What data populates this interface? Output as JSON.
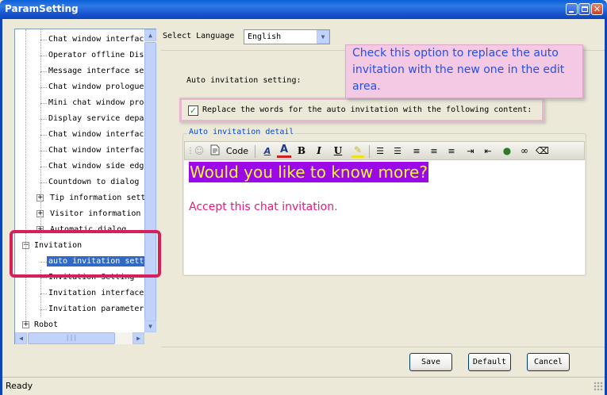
{
  "window": {
    "title": "ParamSetting",
    "controls": {
      "minimize": "minimize-icon",
      "maximize": "maximize-icon",
      "close": "close-icon"
    }
  },
  "tree": {
    "items": [
      {
        "label": "Chat window interfac",
        "level": 1
      },
      {
        "label": "Operator offline Dis",
        "level": 1
      },
      {
        "label": "Message interface se",
        "level": 1
      },
      {
        "label": "Chat window prologue",
        "level": 1
      },
      {
        "label": "Mini chat window pro",
        "level": 1
      },
      {
        "label": "Display service depa",
        "level": 1
      },
      {
        "label": "Chat window interfac",
        "level": 1
      },
      {
        "label": "Chat window interfac",
        "level": 1
      },
      {
        "label": "Chat window side edg",
        "level": 1
      },
      {
        "label": "Countdown to dialog",
        "level": 1
      },
      {
        "label": "Tip information sett",
        "level": 1,
        "expander": "+"
      },
      {
        "label": "Visitor information",
        "level": 1,
        "expander": "+"
      },
      {
        "label": "Automatic dialog",
        "level": 1,
        "expander": "+"
      },
      {
        "label": "Invitation",
        "level": 0,
        "expander": "−"
      },
      {
        "label": "auto invitation sett",
        "level": 1,
        "selected": true
      },
      {
        "label": "Invitation Setting",
        "level": 1
      },
      {
        "label": "Invitation interface",
        "level": 1
      },
      {
        "label": "Invitation parameter",
        "level": 1
      },
      {
        "label": "Robot",
        "level": 0,
        "expander": "+"
      }
    ]
  },
  "language": {
    "label": "Select Language",
    "selected": "English"
  },
  "auto_invitation": {
    "section_label": "Auto invitation setting:",
    "replace_label": "Replace the words for the auto invitation with the following content:",
    "replace_checked": true,
    "detail_legend": "Auto invitation detail"
  },
  "callout": {
    "text": "Check this option to replace the auto invitation with the new one in the edit area."
  },
  "toolbar": {
    "code_label": "Code",
    "bold": "B",
    "italic": "I",
    "underline": "U"
  },
  "editor": {
    "heading": "Would you like to know more?",
    "line": "Accept this chat invitation.",
    "heading_bg": "#9B0AE6",
    "heading_fg": "#F7F73C",
    "line_color": "#E5197E"
  },
  "buttons": {
    "save": "Save",
    "default": "Default",
    "cancel": "Cancel"
  },
  "status": {
    "text": "Ready"
  }
}
